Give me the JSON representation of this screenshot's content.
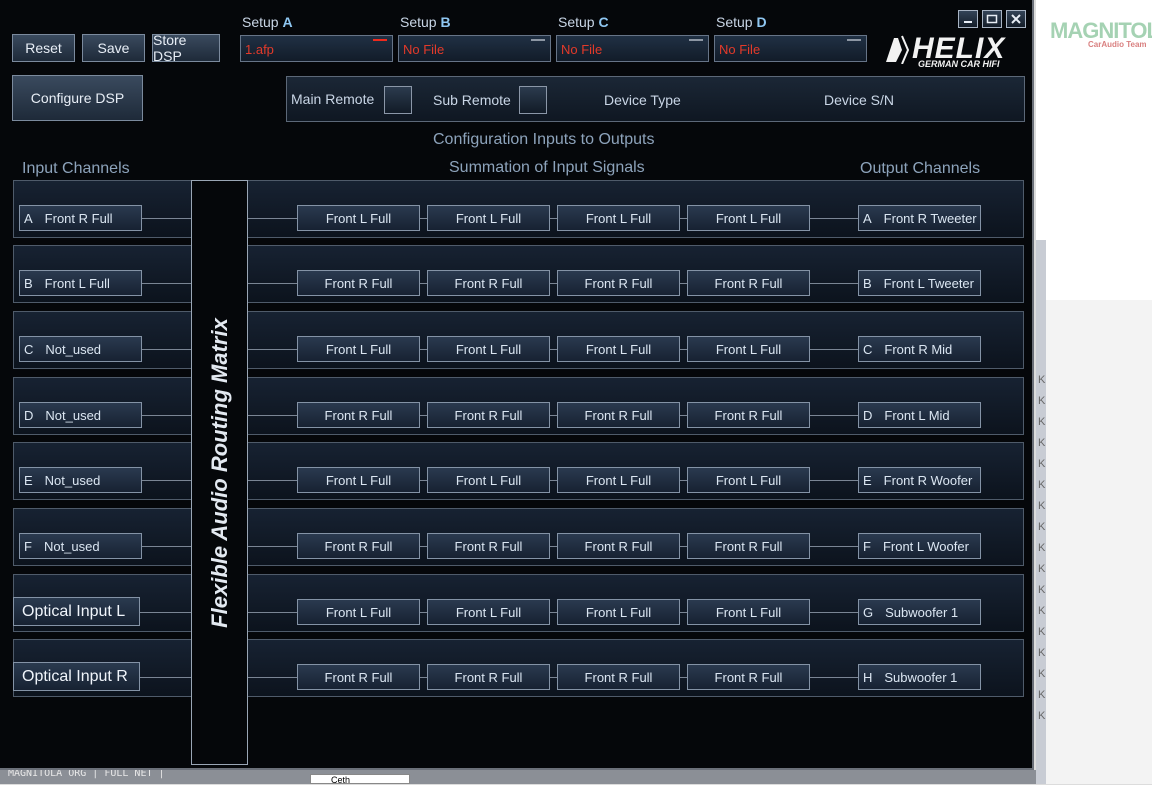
{
  "toolbar": {
    "reset": "Reset",
    "save": "Save",
    "store_dsp": "Store DSP",
    "configure_dsp": "Configure DSP"
  },
  "setups": [
    {
      "prefix": "Setup",
      "letter": "A",
      "file": "1.afp"
    },
    {
      "prefix": "Setup",
      "letter": "B",
      "file": "No File"
    },
    {
      "prefix": "Setup",
      "letter": "C",
      "file": "No File"
    },
    {
      "prefix": "Setup",
      "letter": "D",
      "file": "No File"
    }
  ],
  "logo": {
    "main": "HELIX",
    "sub": "GERMAN CAR HIFI"
  },
  "status": {
    "main_remote": "Main Remote",
    "sub_remote": "Sub Remote",
    "device_type": "Device Type",
    "device_sn": "Device S/N"
  },
  "headings": {
    "config": "Configuration Inputs to Outputs",
    "inputs": "Input Channels",
    "summation": "Summation of Input Signals",
    "outputs": "Output Channels"
  },
  "matrix_label": "Flexible Audio Routing Matrix",
  "inputs": [
    {
      "letter": "A",
      "name": "Front R Full"
    },
    {
      "letter": "B",
      "name": "Front L Full"
    },
    {
      "letter": "C",
      "name": "Not_used"
    },
    {
      "letter": "D",
      "name": "Not_used"
    },
    {
      "letter": "E",
      "name": "Not_used"
    },
    {
      "letter": "F",
      "name": "Not_used"
    }
  ],
  "optical_inputs": [
    "Optical Input L",
    "Optical Input R"
  ],
  "rows": [
    {
      "sums": [
        "Front L Full",
        "Front L Full",
        "Front L Full",
        "Front L Full"
      ],
      "out_letter": "A",
      "out_name": "Front R Tweeter"
    },
    {
      "sums": [
        "Front R Full",
        "Front R Full",
        "Front R Full",
        "Front R Full"
      ],
      "out_letter": "B",
      "out_name": "Front L Tweeter"
    },
    {
      "sums": [
        "Front L Full",
        "Front L Full",
        "Front L Full",
        "Front L Full"
      ],
      "out_letter": "C",
      "out_name": "Front R Mid"
    },
    {
      "sums": [
        "Front R Full",
        "Front R Full",
        "Front R Full",
        "Front R Full"
      ],
      "out_letter": "D",
      "out_name": "Front L Mid"
    },
    {
      "sums": [
        "Front L Full",
        "Front L Full",
        "Front L Full",
        "Front L Full"
      ],
      "out_letter": "E",
      "out_name": "Front R Woofer"
    },
    {
      "sums": [
        "Front R Full",
        "Front R Full",
        "Front R Full",
        "Front R Full"
      ],
      "out_letter": "F",
      "out_name": "Front L Woofer"
    },
    {
      "sums": [
        "Front L Full",
        "Front L Full",
        "Front L Full",
        "Front L Full"
      ],
      "out_letter": "G",
      "out_name": "Subwoofer 1"
    },
    {
      "sums": [
        "Front R Full",
        "Front R Full",
        "Front R Full",
        "Front R Full"
      ],
      "out_letter": "H",
      "out_name": "Subwoofer 1"
    }
  ],
  "background": {
    "watermark": "MAGNITOLA",
    "watermark_sub": "CarAudio Team",
    "bottom_text": "MAGNITOLA ORG | FULL NET |"
  },
  "colors": {
    "accent": "#8fc7f2",
    "file_text": "#e33a2a",
    "panel": "#05070a"
  }
}
